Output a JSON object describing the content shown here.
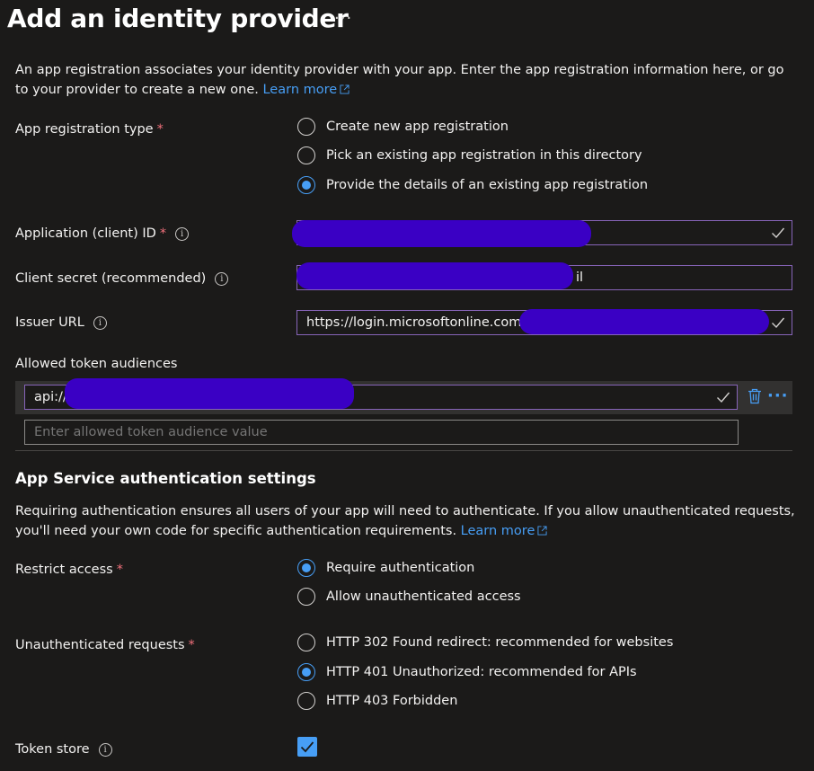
{
  "header": {
    "title": "Add an identity provider",
    "more": "···"
  },
  "intro": {
    "text": "An app registration associates your identity provider with your app. Enter the app registration information here, or go to your provider to create a new one.",
    "link": "Learn more"
  },
  "app_registration_type": {
    "label": "App registration type",
    "required": "*",
    "options": [
      "Create new app registration",
      "Pick an existing app registration in this directory",
      "Provide the details of an existing app registration"
    ],
    "selected_index": 2
  },
  "client_id": {
    "label": "Application (client) ID",
    "required": "*",
    "info": "i",
    "value": ""
  },
  "client_secret": {
    "label": "Client secret (recommended)",
    "info": "i",
    "value_suffix": "il"
  },
  "issuer_url": {
    "label": "Issuer URL",
    "info": "i",
    "value": "https://login.microsoftonline.com"
  },
  "audiences": {
    "label": "Allowed token audiences",
    "values": [
      "api://"
    ],
    "placeholder": "Enter allowed token audience value"
  },
  "auth_settings": {
    "title": "App Service authentication settings",
    "text": "Requiring authentication ensures all users of your app will need to authenticate. If you allow unauthenticated requests, you'll need your own code for specific authentication requirements.",
    "link": "Learn more"
  },
  "restrict_access": {
    "label": "Restrict access",
    "required": "*",
    "options": [
      "Require authentication",
      "Allow unauthenticated access"
    ],
    "selected_index": 0
  },
  "unauthenticated_requests": {
    "label": "Unauthenticated requests",
    "required": "*",
    "options": [
      "HTTP 302 Found redirect: recommended for websites",
      "HTTP 401 Unauthorized: recommended for APIs",
      "HTTP 403 Forbidden"
    ],
    "selected_index": 1
  },
  "token_store": {
    "label": "Token store",
    "info": "i",
    "checked": true
  },
  "colors": {
    "background": "#1b1a19",
    "accent": "#479ef5",
    "required": "#f1707b",
    "field_border": "#8764b8",
    "redaction": "#3a00c4"
  }
}
